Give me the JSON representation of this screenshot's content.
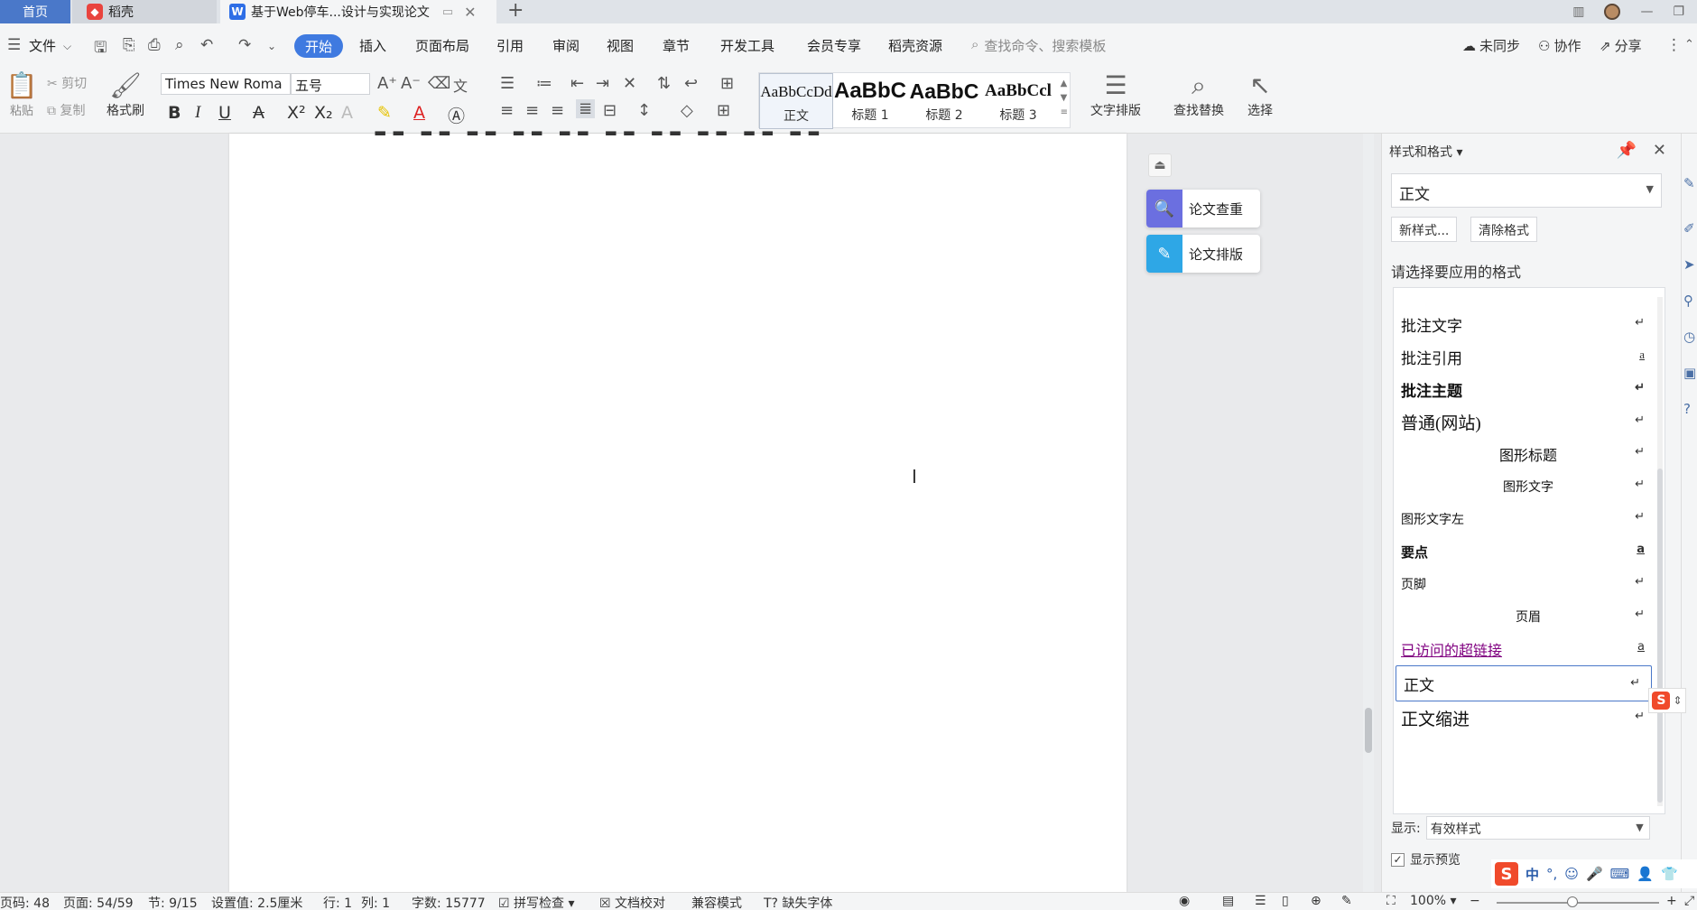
{
  "titlebar": {
    "tabs": [
      {
        "label": "首页"
      },
      {
        "label": "稻壳"
      },
      {
        "label": "基于Web停车...设计与实现论文"
      }
    ],
    "add_label": "+"
  },
  "menubar": {
    "file": "文件",
    "items": [
      "开始",
      "插入",
      "页面布局",
      "引用",
      "审阅",
      "视图",
      "章节",
      "开发工具",
      "会员专享",
      "稻壳资源"
    ],
    "search_placeholder": "查找命令、搜索模板",
    "right": [
      "未同步",
      "协作",
      "分享"
    ]
  },
  "ribbon": {
    "paste": "粘贴",
    "cut": "剪切",
    "copy": "复制",
    "format_painter": "格式刷",
    "font_name": "Times New Roma",
    "font_size": "五号",
    "styles": [
      {
        "preview": "AaBbCcDd",
        "name": "正文"
      },
      {
        "preview": "AaBbC",
        "name": "标题 1"
      },
      {
        "preview": "AaBbC",
        "name": "标题 2"
      },
      {
        "preview": "AaBbCcl",
        "name": "标题 3"
      }
    ],
    "text_layout": "文字排版",
    "find_replace": "查找替换",
    "select": "选择"
  },
  "float_buttons": [
    "论文查重",
    "论文排版"
  ],
  "pane": {
    "title": "样式和格式",
    "current_style": "正文",
    "new_style": "新样式...",
    "clear_format": "清除格式",
    "hint": "请选择要应用的格式",
    "styles": [
      {
        "label": "批注文字",
        "mark": "↵"
      },
      {
        "label": "批注引用",
        "mark": "a"
      },
      {
        "label": "批注主题",
        "mark": "↵"
      },
      {
        "label": "普通(网站)",
        "mark": "↵"
      },
      {
        "label": "图形标题",
        "mark": "↵"
      },
      {
        "label": "图形文字",
        "mark": "↵"
      },
      {
        "label": "图形文字左",
        "mark": "↵"
      },
      {
        "label": "要点",
        "mark": "a"
      },
      {
        "label": "页脚",
        "mark": "↵"
      },
      {
        "label": "页眉",
        "mark": "↵"
      },
      {
        "label": "已访问的超链接",
        "mark": "a"
      },
      {
        "label": "正文",
        "mark": "↵"
      },
      {
        "label": "正文缩进",
        "mark": "↵"
      }
    ],
    "show_label": "显示:",
    "show_value": "有效样式",
    "preview_label": "显示预览"
  },
  "statusbar": {
    "page_code": "页码: 48",
    "page": "页面: 54/59",
    "section": "节: 9/15",
    "setting": "设置值: 2.5厘米",
    "row": "行: 1",
    "col": "列: 1",
    "word_count": "字数: 15777",
    "spell_check": "拼写检查",
    "doc_proof": "文档校对",
    "compat_mode": "兼容模式",
    "missing_font": "缺失字体",
    "zoom": "100%"
  },
  "ime": {
    "lang": "中"
  }
}
